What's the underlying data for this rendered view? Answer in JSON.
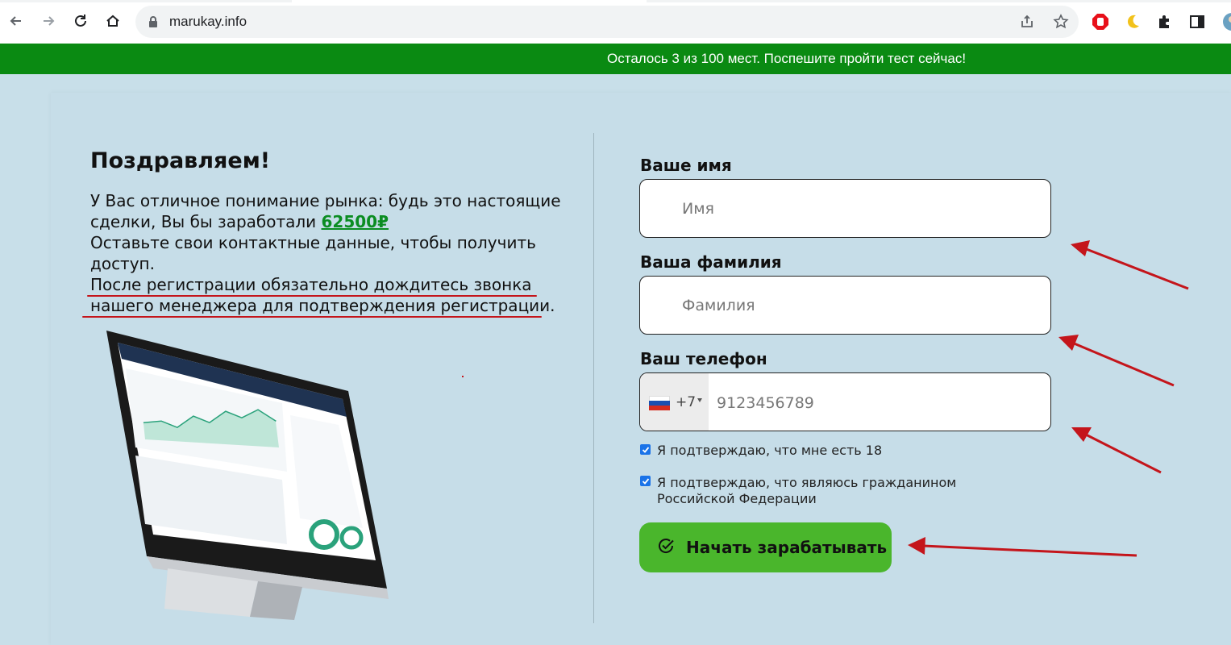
{
  "browser": {
    "url": "marukay.info",
    "icons": [
      "back-arrow-icon",
      "forward-arrow-icon",
      "reload-icon",
      "home-icon",
      "lock-icon",
      "share-icon",
      "star-icon",
      "adblock-icon",
      "moon-icon",
      "puzzle-icon",
      "sidebar-icon",
      "profile-avatar"
    ]
  },
  "banner": {
    "text": "Осталось 3 из 100 мест. Поспешите пройти тест сейчас!"
  },
  "left": {
    "title": "Поздравляем!",
    "line1": "У Вас отличное понимание рынка: будь это настоящие сделки, Вы бы заработали ",
    "amount": "62500₽",
    "line2": "Оставьте свои контактные данные, чтобы получить доступ.",
    "line3": "После регистрации обязательно дождитесь звонка нашего менеджера для подтверждения регистрации."
  },
  "form": {
    "name_label": "Ваше имя",
    "name_placeholder": "Имя",
    "surname_label": "Ваша фамилия",
    "surname_placeholder": "Фамилия",
    "phone_label": "Ваш телефон",
    "phone_code": "+7",
    "phone_placeholder": "9123456789",
    "check_age": "Я подтверждаю, что мне есть 18",
    "check_citizen": "Я подтверждаю, что являюсь гражданином Российской Федерации",
    "submit_label": "Начать зарабатывать"
  },
  "colors": {
    "banner": "#0a8a12",
    "amount": "#0b8d22",
    "button": "#4ab62c",
    "annotation": "#c4151b"
  }
}
